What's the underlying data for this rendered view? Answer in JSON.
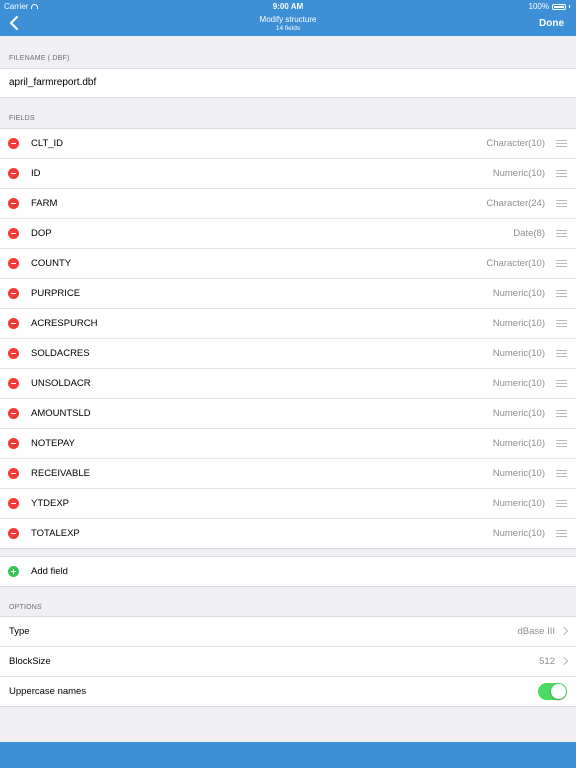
{
  "status": {
    "carrier": "Carrier",
    "time": "9:00 AM",
    "battery": "100%"
  },
  "nav": {
    "title": "Modify structure",
    "subtitle": "14 fields",
    "done_label": "Done"
  },
  "filename_section": {
    "header": "FILENAME (.DBF)",
    "value": "april_farmreport.dbf"
  },
  "fields_section": {
    "header": "FIELDS",
    "fields": [
      {
        "name": "CLT_ID",
        "type": "Character(10)"
      },
      {
        "name": "ID",
        "type": "Numeric(10)"
      },
      {
        "name": "FARM",
        "type": "Character(24)"
      },
      {
        "name": "DOP",
        "type": "Date(8)"
      },
      {
        "name": "COUNTY",
        "type": "Character(10)"
      },
      {
        "name": "PURPRICE",
        "type": "Numeric(10)"
      },
      {
        "name": "ACRESPURCH",
        "type": "Numeric(10)"
      },
      {
        "name": "SOLDACRES",
        "type": "Numeric(10)"
      },
      {
        "name": "UNSOLDACR",
        "type": "Numeric(10)"
      },
      {
        "name": "AMOUNTSLD",
        "type": "Numeric(10)"
      },
      {
        "name": "NOTEPAY",
        "type": "Numeric(10)"
      },
      {
        "name": "RECEIVABLE",
        "type": "Numeric(10)"
      },
      {
        "name": "YTDEXP",
        "type": "Numeric(10)"
      },
      {
        "name": "TOTALEXP",
        "type": "Numeric(10)"
      }
    ],
    "add_label": "Add field"
  },
  "options_section": {
    "header": "OPTIONS",
    "type_label": "Type",
    "type_value": "dBase III",
    "blocksize_label": "BlockSize",
    "blocksize_value": "512",
    "uppercase_label": "Uppercase names",
    "uppercase_on": true
  },
  "colors": {
    "accent": "#3d8fd6",
    "delete": "#f23a34",
    "add": "#39c658",
    "toggle_on": "#4cd964"
  }
}
